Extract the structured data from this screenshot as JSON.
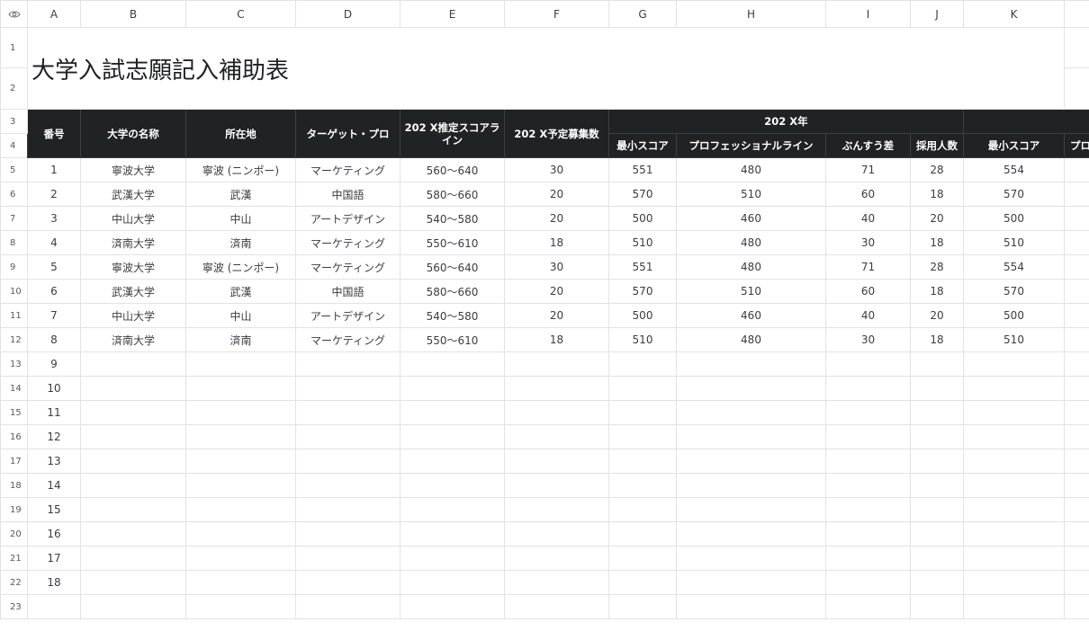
{
  "columns": [
    "A",
    "B",
    "C",
    "D",
    "E",
    "F",
    "G",
    "H",
    "I",
    "J",
    "K"
  ],
  "rows": [
    "1",
    "2",
    "3",
    "4",
    "5",
    "6",
    "7",
    "8",
    "9",
    "10",
    "11",
    "12",
    "13",
    "14",
    "15",
    "16",
    "17",
    "18",
    "19",
    "20",
    "21",
    "22",
    "23"
  ],
  "icons": {
    "corner": "eye-icon"
  },
  "colors": {
    "header_bg": "#202326",
    "grid": "#e1e3e6"
  },
  "title": "大学入試志願記入補助表",
  "headers": {
    "number": "番号",
    "university_name": "大学の名称",
    "location": "所在地",
    "target_program": "ターゲット・プロ",
    "estimated_score_line": "202 X推定スコアライン",
    "planned_recruits": "202 X予定募集数",
    "year_group": "202 X年",
    "min_score": "最小スコア",
    "professional_line": "プロフェッショナルライン",
    "score_diff": "ぶんすう差",
    "hired_count": "採用人数",
    "min_score_2": "最小スコア",
    "pro_cut": "プロ"
  },
  "records": [
    {
      "no": "1",
      "name": "寧波大学",
      "location": "寧波 (ニンポー)",
      "program": "マーケティング",
      "est": "560～640",
      "plan": "30",
      "min": "551",
      "pro": "480",
      "diff": "71",
      "hired": "28",
      "min2": "554"
    },
    {
      "no": "2",
      "name": "武漢大学",
      "location": "武漢",
      "program": "中国語",
      "est": "580～660",
      "plan": "20",
      "min": "570",
      "pro": "510",
      "diff": "60",
      "hired": "18",
      "min2": "570"
    },
    {
      "no": "3",
      "name": "中山大学",
      "location": "中山",
      "program": "アートデザイン",
      "est": "540～580",
      "plan": "20",
      "min": "500",
      "pro": "460",
      "diff": "40",
      "hired": "20",
      "min2": "500"
    },
    {
      "no": "4",
      "name": "済南大学",
      "location": "済南",
      "program": "マーケティング",
      "est": "550～610",
      "plan": "18",
      "min": "510",
      "pro": "480",
      "diff": "30",
      "hired": "18",
      "min2": "510"
    },
    {
      "no": "5",
      "name": "寧波大学",
      "location": "寧波 (ニンポー)",
      "program": "マーケティング",
      "est": "560～640",
      "plan": "30",
      "min": "551",
      "pro": "480",
      "diff": "71",
      "hired": "28",
      "min2": "554"
    },
    {
      "no": "6",
      "name": "武漢大学",
      "location": "武漢",
      "program": "中国語",
      "est": "580～660",
      "plan": "20",
      "min": "570",
      "pro": "510",
      "diff": "60",
      "hired": "18",
      "min2": "570"
    },
    {
      "no": "7",
      "name": "中山大学",
      "location": "中山",
      "program": "アートデザイン",
      "est": "540～580",
      "plan": "20",
      "min": "500",
      "pro": "460",
      "diff": "40",
      "hired": "20",
      "min2": "500"
    },
    {
      "no": "8",
      "name": "済南大学",
      "location": "済南",
      "program": "マーケティング",
      "est": "550～610",
      "plan": "18",
      "min": "510",
      "pro": "480",
      "diff": "30",
      "hired": "18",
      "min2": "510"
    }
  ],
  "empty_numbers": [
    "9",
    "10",
    "11",
    "12",
    "13",
    "14",
    "15",
    "16",
    "17",
    "18"
  ]
}
